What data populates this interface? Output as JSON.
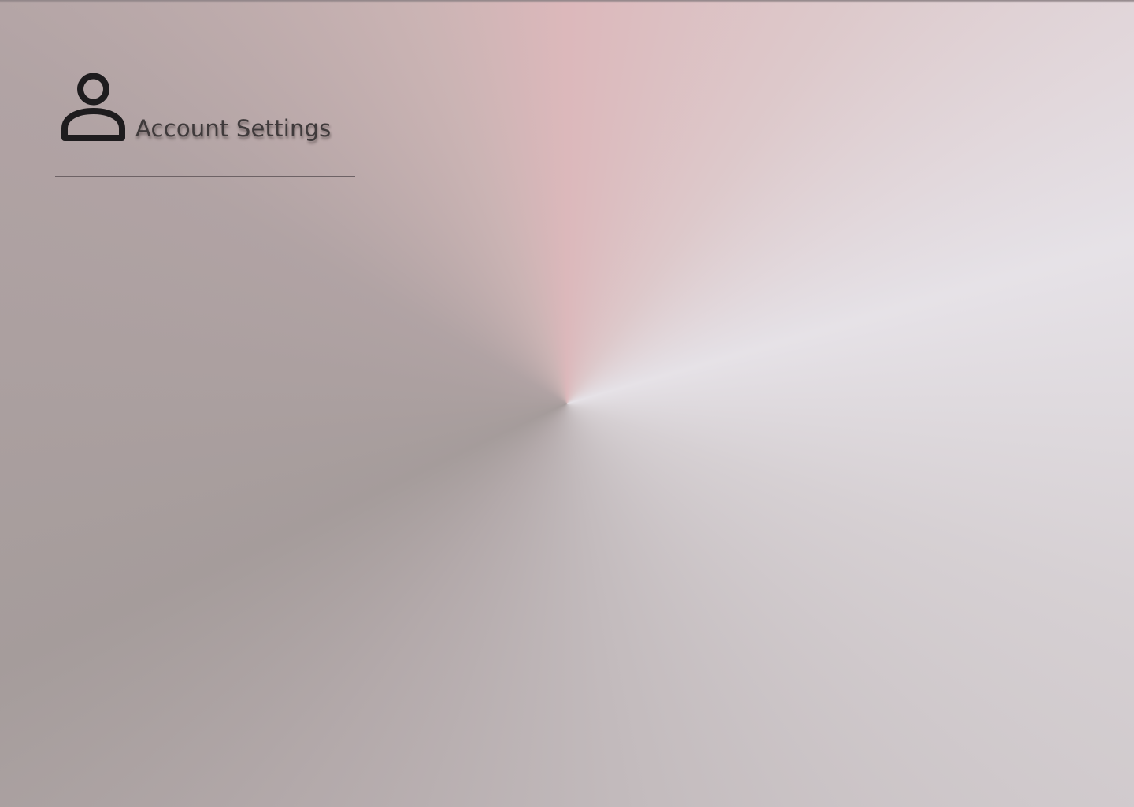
{
  "header": {
    "icon": "user-icon",
    "title": "Account Settings"
  },
  "colors": {
    "title_text": "#3f3a3b",
    "icon": "#1e1c1e",
    "divider": "#6d6265"
  }
}
